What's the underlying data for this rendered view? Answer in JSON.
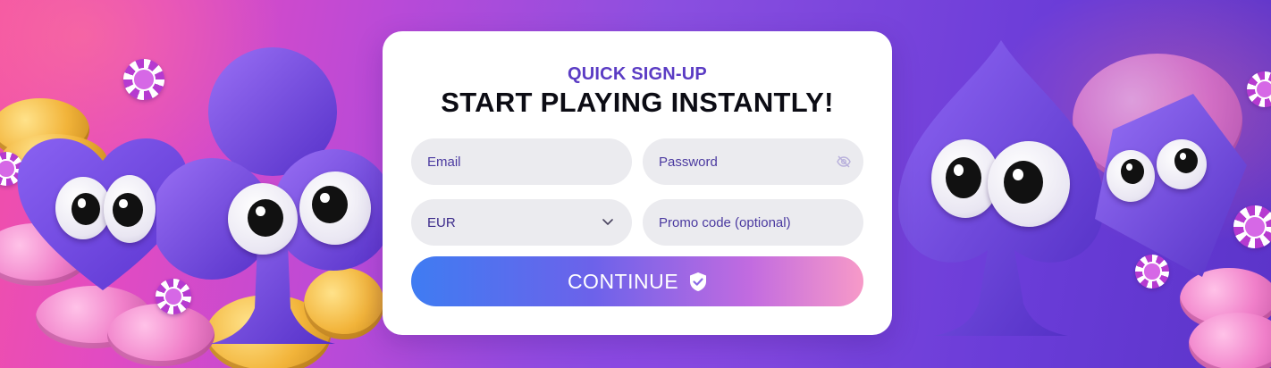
{
  "form": {
    "kicker": "QUICK SIGN-UP",
    "headline": "START PLAYING INSTANTLY!",
    "email": {
      "placeholder": "Email",
      "value": ""
    },
    "password": {
      "placeholder": "Password",
      "value": "",
      "toggle_icon": "eye-off-icon"
    },
    "currency": {
      "selected": "EUR",
      "icon": "chevron-down-icon"
    },
    "promo": {
      "placeholder": "Promo code (optional)",
      "value": ""
    },
    "continue_label": "CONTINUE",
    "continue_icon": "shield-check-icon"
  },
  "colors": {
    "accent": "#5b3cc4",
    "button_start": "#3f7cf2",
    "button_end": "#f79ac8",
    "field_bg": "#ebebef",
    "background_start": "#f24fa8",
    "background_end": "#5b34c9"
  }
}
